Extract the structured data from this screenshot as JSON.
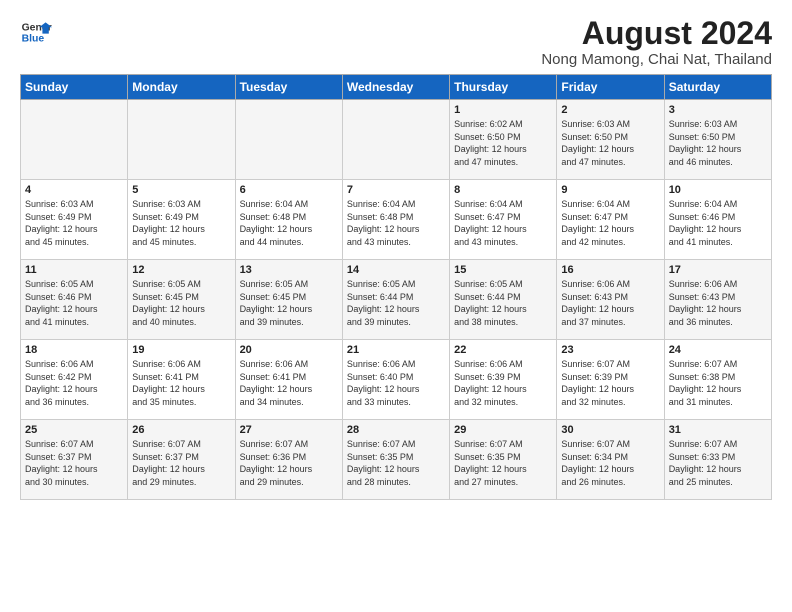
{
  "logo": {
    "line1": "General",
    "line2": "Blue"
  },
  "title": "August 2024",
  "subtitle": "Nong Mamong, Chai Nat, Thailand",
  "days_of_week": [
    "Sunday",
    "Monday",
    "Tuesday",
    "Wednesday",
    "Thursday",
    "Friday",
    "Saturday"
  ],
  "weeks": [
    [
      {
        "day": "",
        "content": ""
      },
      {
        "day": "",
        "content": ""
      },
      {
        "day": "",
        "content": ""
      },
      {
        "day": "",
        "content": ""
      },
      {
        "day": "1",
        "content": "Sunrise: 6:02 AM\nSunset: 6:50 PM\nDaylight: 12 hours\nand 47 minutes."
      },
      {
        "day": "2",
        "content": "Sunrise: 6:03 AM\nSunset: 6:50 PM\nDaylight: 12 hours\nand 47 minutes."
      },
      {
        "day": "3",
        "content": "Sunrise: 6:03 AM\nSunset: 6:50 PM\nDaylight: 12 hours\nand 46 minutes."
      }
    ],
    [
      {
        "day": "4",
        "content": "Sunrise: 6:03 AM\nSunset: 6:49 PM\nDaylight: 12 hours\nand 45 minutes."
      },
      {
        "day": "5",
        "content": "Sunrise: 6:03 AM\nSunset: 6:49 PM\nDaylight: 12 hours\nand 45 minutes."
      },
      {
        "day": "6",
        "content": "Sunrise: 6:04 AM\nSunset: 6:48 PM\nDaylight: 12 hours\nand 44 minutes."
      },
      {
        "day": "7",
        "content": "Sunrise: 6:04 AM\nSunset: 6:48 PM\nDaylight: 12 hours\nand 43 minutes."
      },
      {
        "day": "8",
        "content": "Sunrise: 6:04 AM\nSunset: 6:47 PM\nDaylight: 12 hours\nand 43 minutes."
      },
      {
        "day": "9",
        "content": "Sunrise: 6:04 AM\nSunset: 6:47 PM\nDaylight: 12 hours\nand 42 minutes."
      },
      {
        "day": "10",
        "content": "Sunrise: 6:04 AM\nSunset: 6:46 PM\nDaylight: 12 hours\nand 41 minutes."
      }
    ],
    [
      {
        "day": "11",
        "content": "Sunrise: 6:05 AM\nSunset: 6:46 PM\nDaylight: 12 hours\nand 41 minutes."
      },
      {
        "day": "12",
        "content": "Sunrise: 6:05 AM\nSunset: 6:45 PM\nDaylight: 12 hours\nand 40 minutes."
      },
      {
        "day": "13",
        "content": "Sunrise: 6:05 AM\nSunset: 6:45 PM\nDaylight: 12 hours\nand 39 minutes."
      },
      {
        "day": "14",
        "content": "Sunrise: 6:05 AM\nSunset: 6:44 PM\nDaylight: 12 hours\nand 39 minutes."
      },
      {
        "day": "15",
        "content": "Sunrise: 6:05 AM\nSunset: 6:44 PM\nDaylight: 12 hours\nand 38 minutes."
      },
      {
        "day": "16",
        "content": "Sunrise: 6:06 AM\nSunset: 6:43 PM\nDaylight: 12 hours\nand 37 minutes."
      },
      {
        "day": "17",
        "content": "Sunrise: 6:06 AM\nSunset: 6:43 PM\nDaylight: 12 hours\nand 36 minutes."
      }
    ],
    [
      {
        "day": "18",
        "content": "Sunrise: 6:06 AM\nSunset: 6:42 PM\nDaylight: 12 hours\nand 36 minutes."
      },
      {
        "day": "19",
        "content": "Sunrise: 6:06 AM\nSunset: 6:41 PM\nDaylight: 12 hours\nand 35 minutes."
      },
      {
        "day": "20",
        "content": "Sunrise: 6:06 AM\nSunset: 6:41 PM\nDaylight: 12 hours\nand 34 minutes."
      },
      {
        "day": "21",
        "content": "Sunrise: 6:06 AM\nSunset: 6:40 PM\nDaylight: 12 hours\nand 33 minutes."
      },
      {
        "day": "22",
        "content": "Sunrise: 6:06 AM\nSunset: 6:39 PM\nDaylight: 12 hours\nand 32 minutes."
      },
      {
        "day": "23",
        "content": "Sunrise: 6:07 AM\nSunset: 6:39 PM\nDaylight: 12 hours\nand 32 minutes."
      },
      {
        "day": "24",
        "content": "Sunrise: 6:07 AM\nSunset: 6:38 PM\nDaylight: 12 hours\nand 31 minutes."
      }
    ],
    [
      {
        "day": "25",
        "content": "Sunrise: 6:07 AM\nSunset: 6:37 PM\nDaylight: 12 hours\nand 30 minutes."
      },
      {
        "day": "26",
        "content": "Sunrise: 6:07 AM\nSunset: 6:37 PM\nDaylight: 12 hours\nand 29 minutes."
      },
      {
        "day": "27",
        "content": "Sunrise: 6:07 AM\nSunset: 6:36 PM\nDaylight: 12 hours\nand 29 minutes."
      },
      {
        "day": "28",
        "content": "Sunrise: 6:07 AM\nSunset: 6:35 PM\nDaylight: 12 hours\nand 28 minutes."
      },
      {
        "day": "29",
        "content": "Sunrise: 6:07 AM\nSunset: 6:35 PM\nDaylight: 12 hours\nand 27 minutes."
      },
      {
        "day": "30",
        "content": "Sunrise: 6:07 AM\nSunset: 6:34 PM\nDaylight: 12 hours\nand 26 minutes."
      },
      {
        "day": "31",
        "content": "Sunrise: 6:07 AM\nSunset: 6:33 PM\nDaylight: 12 hours\nand 25 minutes."
      }
    ]
  ]
}
